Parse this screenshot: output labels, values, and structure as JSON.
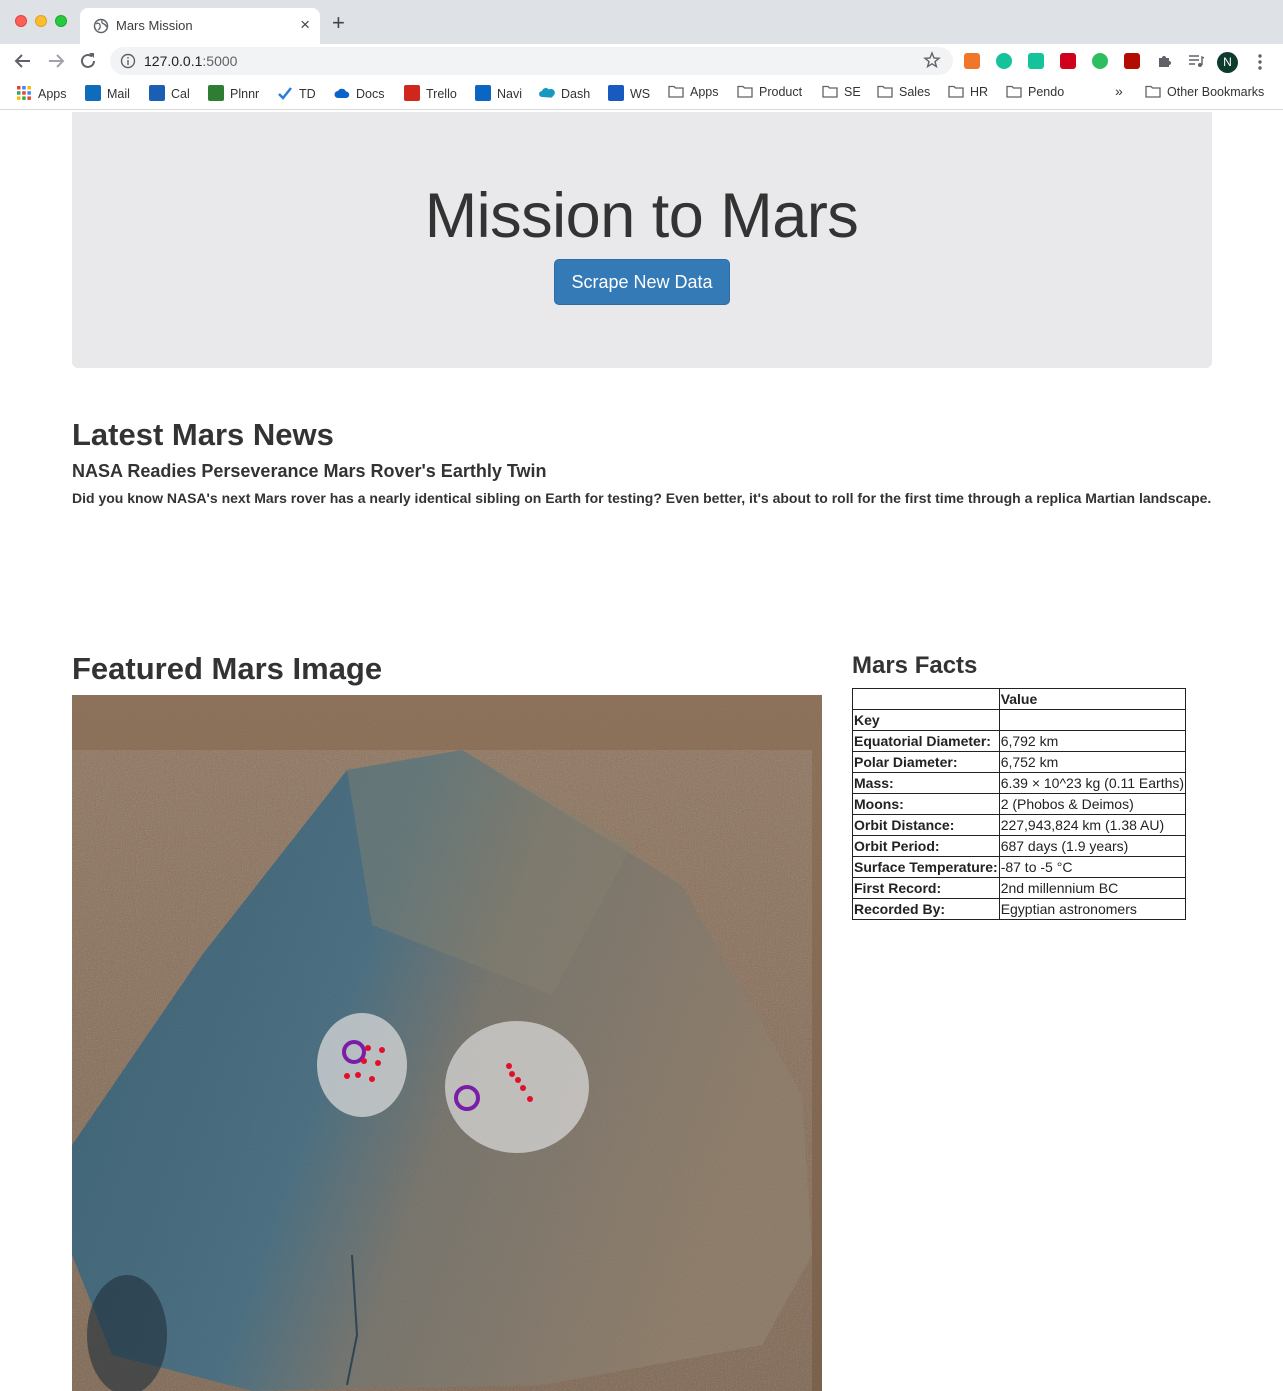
{
  "browser": {
    "tab_title": "Mars Mission",
    "url_host": "127.0.0.1",
    "url_port": ":5000",
    "profile_initial": "N",
    "bookmarks": [
      "Apps",
      "Mail",
      "Cal",
      "Plnnr",
      "TD",
      "Docs",
      "Trello",
      "Navi",
      "Dash",
      "WS",
      "Apps",
      "Product",
      "SE",
      "Sales",
      "HR",
      "Pendo"
    ],
    "more_bookmarks": "»",
    "other_bookmarks": "Other Bookmarks"
  },
  "hero": {
    "title": "Mission to Mars",
    "button_label": "Scrape New Data",
    "button_color": "#337ab7"
  },
  "news": {
    "heading": "Latest Mars News",
    "title": "NASA Readies Perseverance Mars Rover's Earthly Twin",
    "paragraph": "Did you know NASA's next Mars rover has a nearly identical sibling on Earth for testing? Even better, it's about to roll for the first time through a replica Martian landscape."
  },
  "featured_image": {
    "heading": "Featured Mars Image"
  },
  "facts": {
    "heading": "Mars Facts",
    "header_value": "Value",
    "index_label": "Key",
    "rows": [
      {
        "key": "Equatorial Diameter:",
        "value": "6,792 km"
      },
      {
        "key": "Polar Diameter:",
        "value": "6,752 km"
      },
      {
        "key": "Mass:",
        "value": "6.39 × 10^23 kg (0.11 Earths)"
      },
      {
        "key": "Moons:",
        "value": "2 (Phobos & Deimos)"
      },
      {
        "key": "Orbit Distance:",
        "value": "227,943,824 km (1.38 AU)"
      },
      {
        "key": "Orbit Period:",
        "value": "687 days (1.9 years)"
      },
      {
        "key": "Surface Temperature:",
        "value": "-87 to -5 °C"
      },
      {
        "key": "First Record:",
        "value": "2nd millennium BC"
      },
      {
        "key": "Recorded By:",
        "value": "Egyptian astronomers"
      }
    ]
  }
}
